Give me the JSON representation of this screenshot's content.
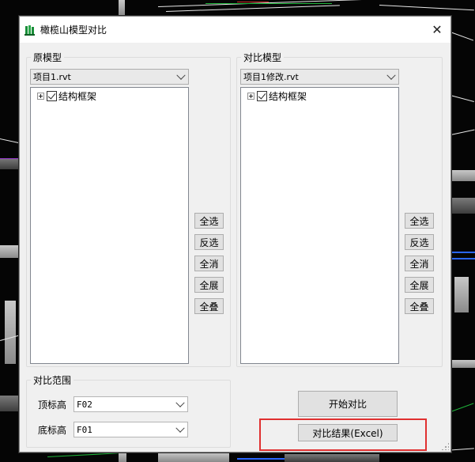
{
  "window": {
    "title": "橄榄山模型对比",
    "close_symbol": "✕"
  },
  "original_model": {
    "group_label": "原模型",
    "selected_file": "项目1.rvt",
    "tree_root_label": "结构框架",
    "tree_root_checked": true
  },
  "compare_model": {
    "group_label": "对比模型",
    "selected_file": "项目1修改.rvt",
    "tree_root_label": "结构框架",
    "tree_root_checked": true
  },
  "tree_buttons": [
    "全选",
    "反选",
    "全消",
    "全展",
    "全叠"
  ],
  "range": {
    "group_label": "对比范围",
    "top_level_label": "顶标高",
    "top_level_value": "F02",
    "bottom_level_label": "底标高",
    "bottom_level_value": "F01"
  },
  "actions": {
    "start_compare": "开始对比",
    "compare_result": "对比结果(Excel)"
  },
  "colors": {
    "highlight": "#e03030",
    "dialog_bg": "#f0f0f0",
    "cad_background": "#050505"
  }
}
